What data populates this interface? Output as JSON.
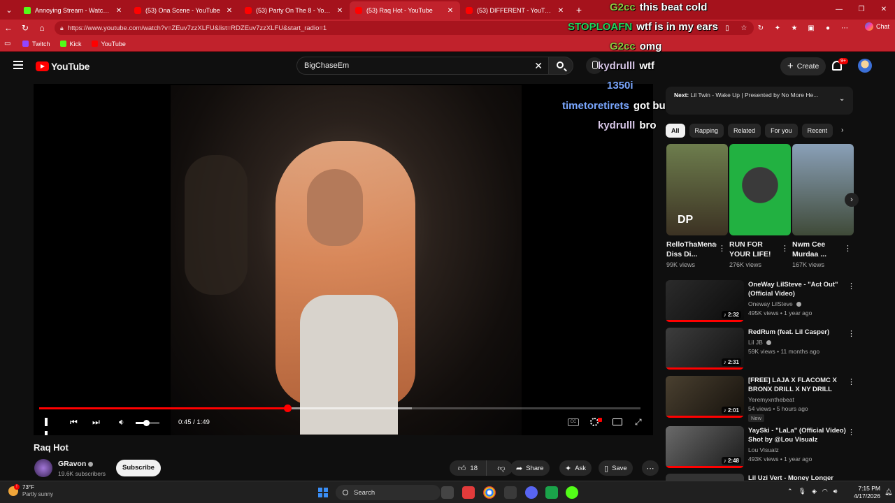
{
  "browser": {
    "tabs": [
      {
        "label": "Annoying Stream - Watch Live on",
        "icon": "kick",
        "active": false
      },
      {
        "label": "(53) Ona Scene - YouTube",
        "icon": "yt",
        "active": false
      },
      {
        "label": "(53) Party On The 8 - YouTube",
        "icon": "yt",
        "active": false
      },
      {
        "label": "(53) Raq Hot - YouTube",
        "icon": "yt",
        "active": true
      },
      {
        "label": "(53) DIFFERENT - YouTube",
        "icon": "yt",
        "active": false
      }
    ],
    "url": "https://www.youtube.com/watch?v=ZEuv7zzXLFU&list=RDZEuv7zzXLFU&start_radio=1",
    "chat_label": "Chat",
    "bookmarks": [
      "Twitch",
      "Kick",
      "YouTube"
    ]
  },
  "youtube": {
    "logo": "YouTube",
    "search_value": "BigChaseEm",
    "create_label": "Create",
    "notif_count": "9+"
  },
  "player": {
    "time": "0:45 / 1:49",
    "played_fraction": 0.4128,
    "buffered_fraction": 0.62,
    "volume_fraction": 0.45
  },
  "video": {
    "title": "Raq Hot",
    "channel": "GRavon",
    "subscribers": "19.6K subscribers",
    "subscribe_label": "Subscribe",
    "likes": "18",
    "share_label": "Share",
    "ask_label": "Ask",
    "save_label": "Save"
  },
  "chat": [
    {
      "user": "G2cc",
      "msg": "this beat cold",
      "color": "#8dc63f"
    },
    {
      "user": "STOPLOAFN",
      "msg": "wtf is in my ears",
      "color": "#21d35c"
    },
    {
      "user": "G2cc",
      "msg": "omg",
      "color": "#8dc63f"
    },
    {
      "user": "kydrulll",
      "msg": "wtf",
      "color": "#d8c7e8"
    },
    {
      "user": "1350i",
      "msg": "",
      "color": "#7aa7ff"
    },
    {
      "user": "timetoretirets",
      "msg": "got bulles now @melvdy",
      "color": "#7aa7ff"
    },
    {
      "user": "kydrulll",
      "msg": "bro",
      "color": "#d8c7e8"
    }
  ],
  "up_next": {
    "prefix": "Next:",
    "text": "Lil Twin - Wake Up | Presented by No More He..."
  },
  "chips": [
    "All",
    "Rapping",
    "Related",
    "For you",
    "Recent"
  ],
  "shorts": [
    {
      "title": "RelloThaMenace Diss Di...",
      "views": "99K views",
      "thumb_bg": "#5a6a43"
    },
    {
      "title": "RUN FOR YOUR LIFE!",
      "views": "276K views",
      "thumb_bg": "#1e9e34"
    },
    {
      "title": "Nwm Cee Murdaa ...",
      "views": "167K views",
      "thumb_bg": "#5d6a78"
    }
  ],
  "short_overlay": "DP",
  "recommendations": [
    {
      "title": "OneWay LilSteve - \"Act Out\" (Official Video)",
      "channel": "Oneway LilSteve",
      "meta": "495K views • 1 year ago",
      "duration": "2:32",
      "badge": "",
      "verified": true,
      "progress": 1.0
    },
    {
      "title": "RedRum (feat. Lil Casper)",
      "channel": "Lil JB",
      "meta": "59K views • 11 months ago",
      "duration": "2:31",
      "badge": "",
      "verified": true,
      "progress": 1.0
    },
    {
      "title": "[FREE] LAJA X FLACOMC X BRONX DRILL X NY DRILL TYP...",
      "channel": "Yeremyxnthebeat",
      "meta": "54 views • 5 hours ago",
      "duration": "2:01",
      "badge": "New",
      "verified": false,
      "progress": 1.0
    },
    {
      "title": "YaySki - \"LaLa\" (Official Video) Shot by @Lou Visualz",
      "channel": "Lou Visualz",
      "meta": "493K views • 1 year ago",
      "duration": "2:48",
      "badge": "",
      "verified": false,
      "progress": 1.0
    },
    {
      "title": "Lil Uzi Vert - Money Longer",
      "channel": "",
      "meta": "",
      "duration": "",
      "badge": "",
      "verified": false,
      "progress": 0
    }
  ],
  "taskbar": {
    "temp": "73°F",
    "weather": "Partly sunny",
    "search_placeholder": "Search",
    "time": "7:15 PM",
    "date": "4/17/2026"
  }
}
